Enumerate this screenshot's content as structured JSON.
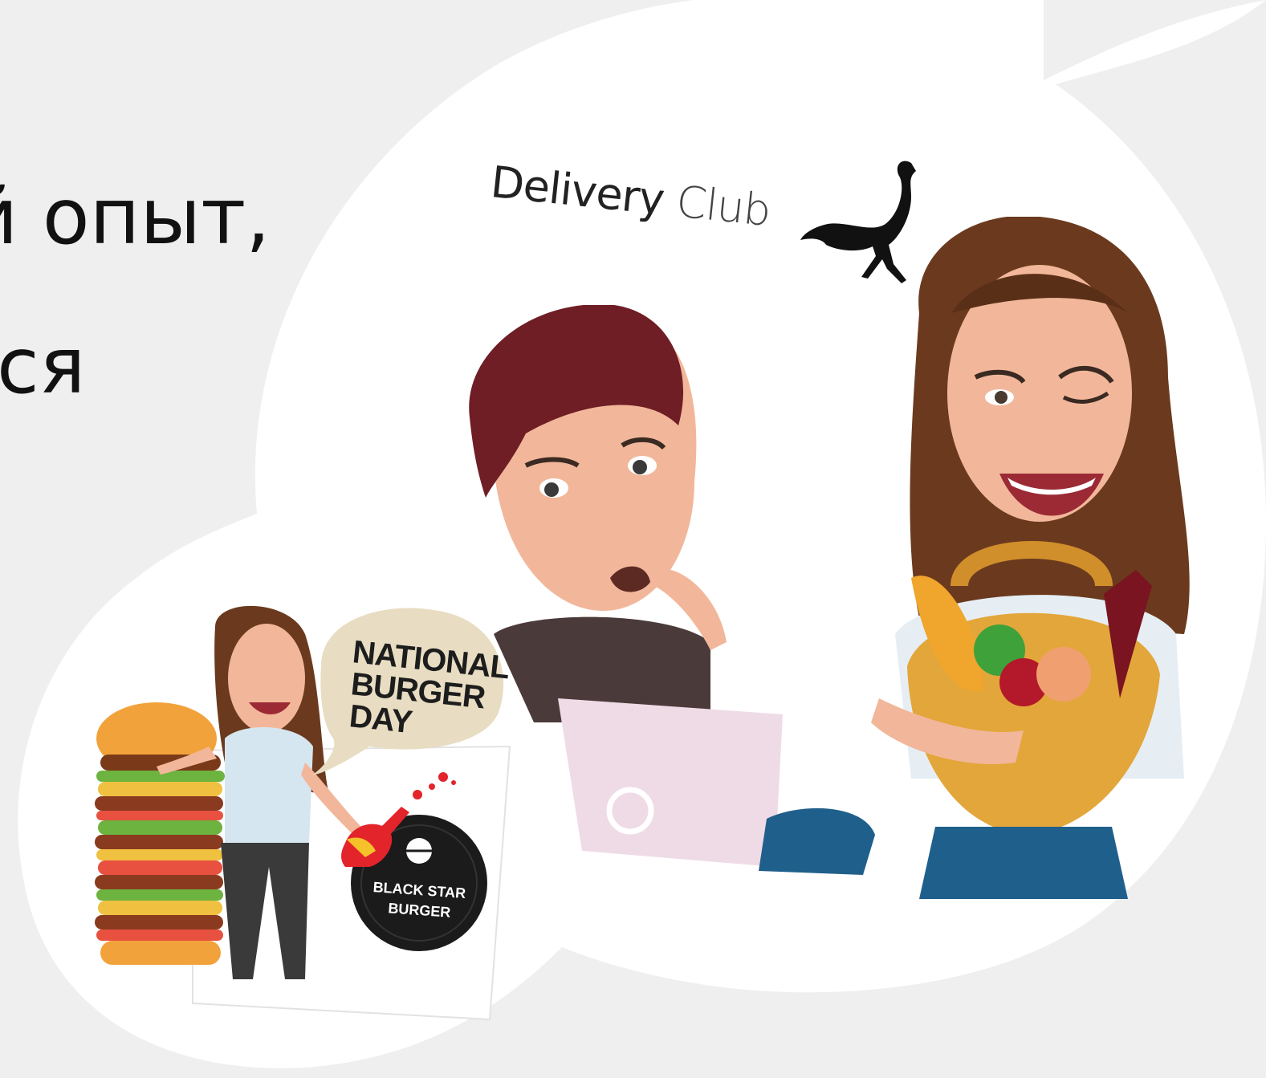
{
  "heading": {
    "line1": "й опыт,",
    "line2": "ся"
  },
  "delivery_logo": {
    "word1": "Delivery",
    "word2": "Club",
    "mascot_icon": "ostrich-icon"
  },
  "burger_sticker": {
    "bubble_line1": "NATIONAL",
    "bubble_line2": "BURGER",
    "bubble_line3": "DAY",
    "badge_line1": "BLACK STAR",
    "badge_line2": "BURGER"
  },
  "colors": {
    "background": "#efefef",
    "sticker_white": "#ffffff",
    "hair_brown": "#6b3a1e",
    "skin": "#f2b79a",
    "basket": "#e3a63a",
    "laptop": "#efdbe6",
    "jeans": "#1f5f8b"
  }
}
